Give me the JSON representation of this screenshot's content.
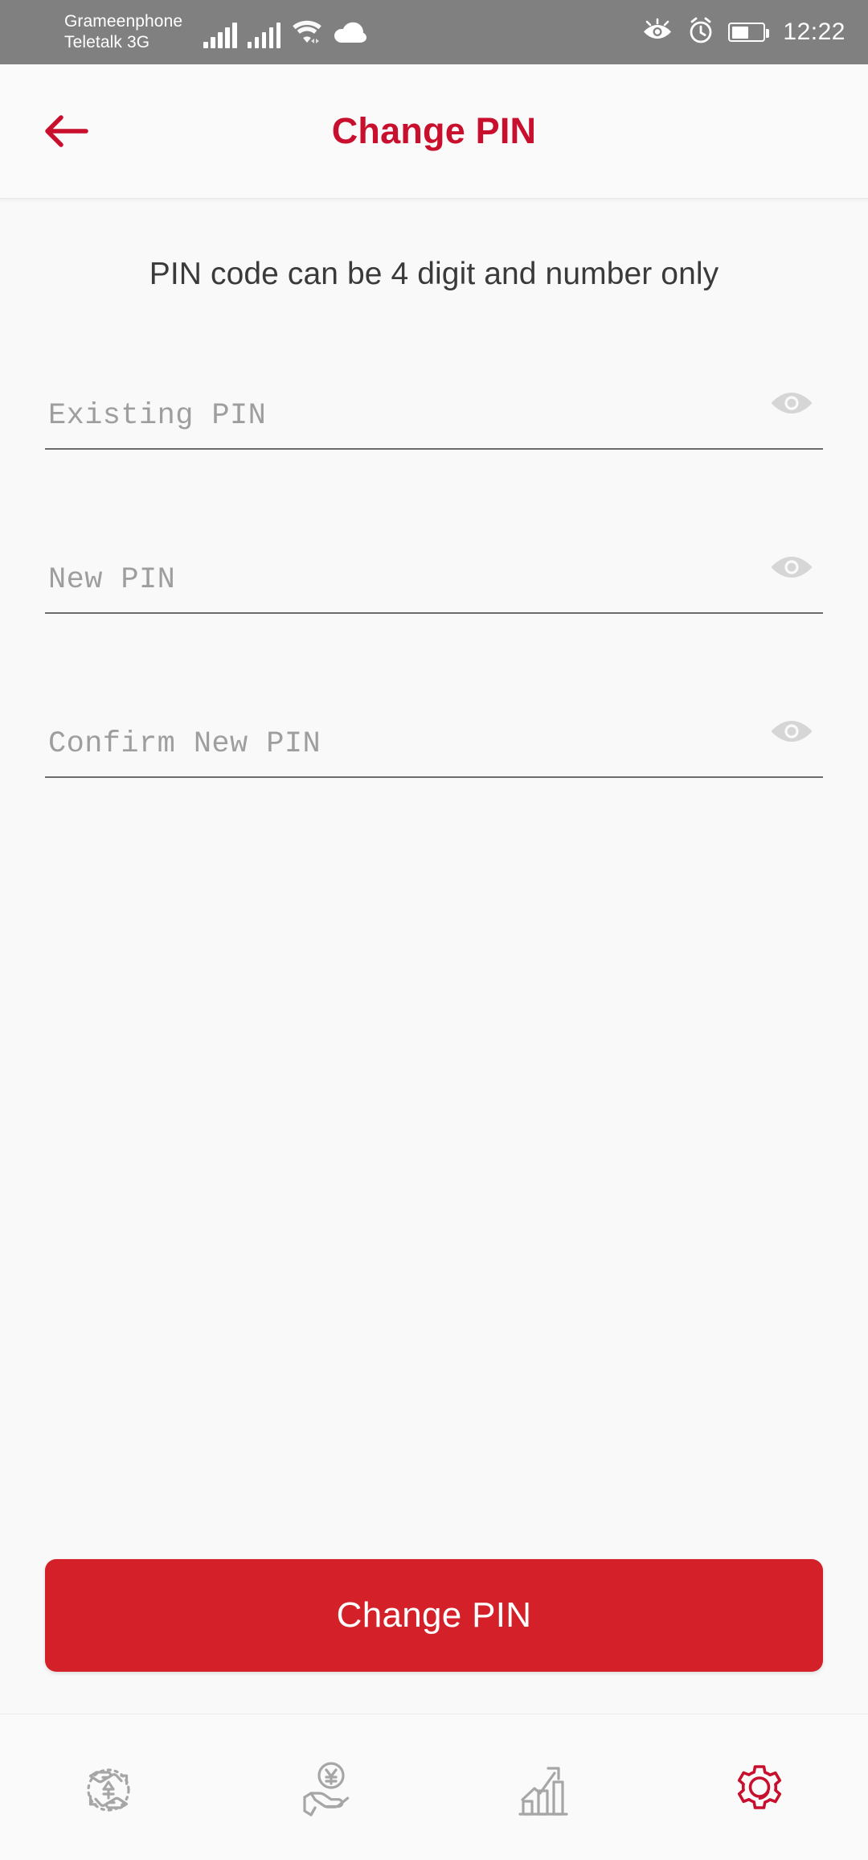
{
  "status_bar": {
    "carrier_line1": "Grameenphone",
    "carrier_line2": "Teletalk 3G",
    "time": "12:22",
    "icons": [
      "signal-bars-sim1",
      "signal-bars-sim2",
      "wifi-icon",
      "cloud-icon",
      "eye-care-icon",
      "alarm-clock-icon",
      "battery-icon"
    ],
    "battery_percent": 55,
    "background": "#808080"
  },
  "app_bar": {
    "title": "Change PIN",
    "back_icon": "arrow-left-icon",
    "accent_color": "#c8102e"
  },
  "main": {
    "hint": "PIN code can be 4 digit and number only",
    "fields": [
      {
        "name": "existing-pin",
        "placeholder": "Existing PIN",
        "value": "",
        "toggle_icon": "eye-icon"
      },
      {
        "name": "new-pin",
        "placeholder": "New PIN",
        "value": "",
        "toggle_icon": "eye-icon"
      },
      {
        "name": "confirm-new-pin",
        "placeholder": "Confirm New PIN",
        "value": "",
        "toggle_icon": "eye-icon"
      }
    ],
    "submit_label": "Change PIN",
    "submit_color": "#d32029"
  },
  "bottom_nav": {
    "items": [
      {
        "name": "transfer-money",
        "icon": "hands-exchange-money-icon",
        "active": false
      },
      {
        "name": "receive-money",
        "icon": "hand-holding-coin-icon",
        "active": false
      },
      {
        "name": "statistics",
        "icon": "growth-chart-icon",
        "active": false
      },
      {
        "name": "settings",
        "icon": "gear-icon",
        "active": true
      }
    ],
    "active_color": "#c8102e",
    "inactive_color": "#a6a6a6"
  }
}
